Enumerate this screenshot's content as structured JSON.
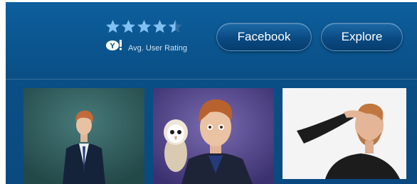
{
  "rating": {
    "value": 4.5,
    "max": 5,
    "label": "Avg. User Rating",
    "icon": "yahoo-logo-icon",
    "star_color": "#7fc2f2"
  },
  "buttons": {
    "facebook_label": "Facebook",
    "explore_label": "Explore"
  },
  "gallery": {
    "photos": [
      {
        "subject": "man in suit",
        "background": "#2f5e60"
      },
      {
        "subject": "man with owl",
        "background": "#5a4c8c"
      },
      {
        "subject": "man shading eyes",
        "background": "#f2f2f2"
      }
    ]
  },
  "colors": {
    "panel": "#0a4f86",
    "button_text": "#ffffff"
  }
}
